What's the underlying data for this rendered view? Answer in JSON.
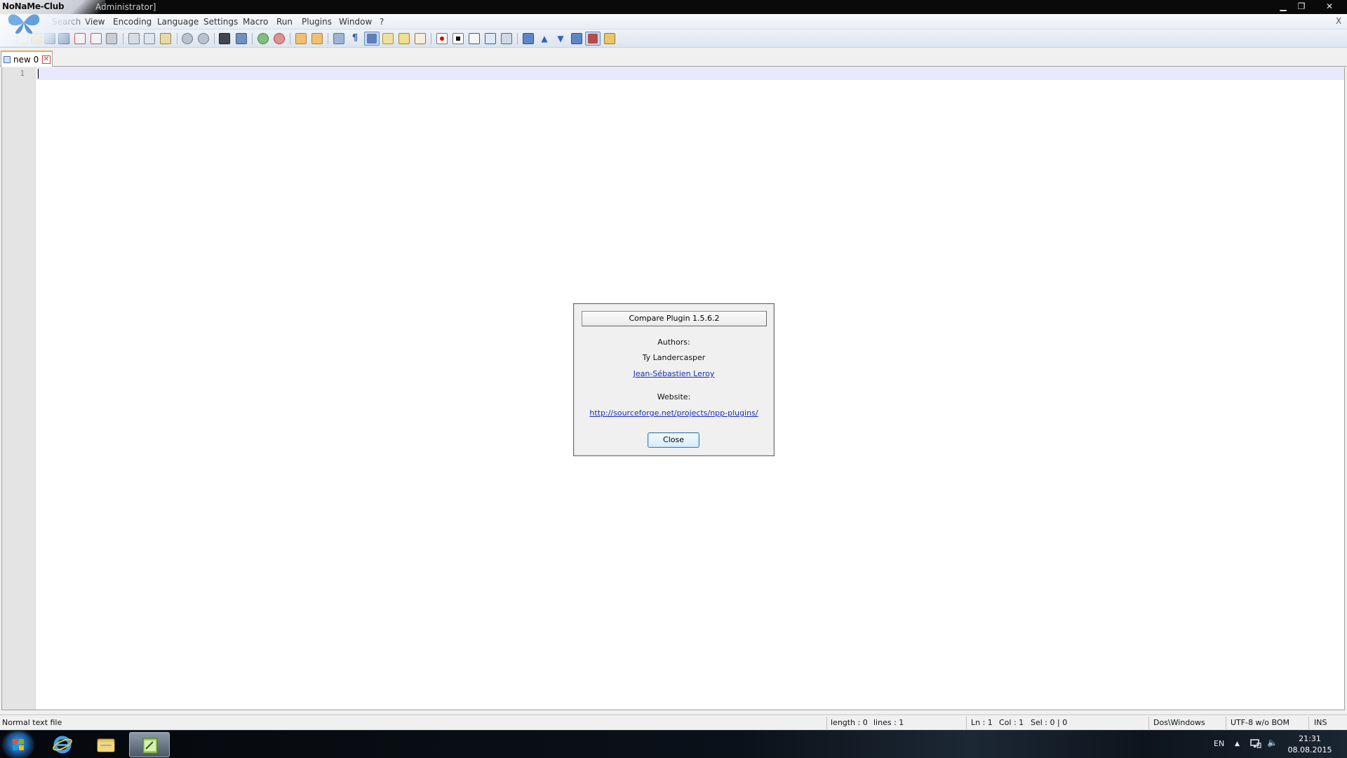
{
  "window": {
    "title": "Administrator]",
    "watermark": "NoNaMe-Club",
    "minimize_glyph": "▁",
    "maximize_glyph": "❐",
    "close_glyph": "✕"
  },
  "menu": {
    "items": [
      "Search",
      "View",
      "Encoding",
      "Language",
      "Settings",
      "Macro",
      "Run",
      "Plugins",
      "Window",
      "?"
    ],
    "doc_close": "X"
  },
  "tabs": [
    {
      "label": "new  0",
      "close_glyph": "✕"
    }
  ],
  "editor": {
    "line_numbers": [
      "1"
    ]
  },
  "dialog": {
    "title": "Compare Plugin 1.5.6.2",
    "authors_label": "Authors:",
    "author_1": "Ty Landercasper",
    "author_2": "Jean-Sébastien Leroy",
    "website_label": "Website:",
    "website_url": "http://sourceforge.net/projects/npp-plugins/",
    "close_label": "Close"
  },
  "statusbar": {
    "file_type": "Normal text file",
    "length": "length : 0",
    "lines": "lines : 1",
    "ln": "Ln : 1",
    "col": "Col : 1",
    "sel": "Sel : 0 | 0",
    "eol": "Dos\\Windows",
    "encoding": "UTF-8 w/o BOM",
    "mode": "INS"
  },
  "taskbar": {
    "language": "EN",
    "time": "21:31",
    "date": "08.08.2015",
    "show_hidden_glyph": "▲",
    "volume_glyph": "🔈"
  },
  "colors": {
    "accent_tab": "#f6a650",
    "link": "#1a2fb5",
    "current_line": "#e8e8ff"
  },
  "icons": {
    "toolbar": [
      "new-file-icon",
      "open-file-icon",
      "save-icon",
      "save-all-icon",
      "close-icon",
      "close-all-icon",
      "print-icon",
      "cut-icon",
      "copy-icon",
      "paste-icon",
      "undo-icon",
      "redo-icon",
      "find-icon",
      "replace-icon",
      "zoom-in-icon",
      "zoom-out-icon",
      "sync-vertical-icon",
      "sync-horizontal-icon",
      "word-wrap-icon",
      "show-all-chars-icon",
      "indent-guide-icon",
      "user-define-icon",
      "doc-map-icon",
      "function-list-icon",
      "record-macro-icon",
      "stop-record-icon",
      "play-macro-icon",
      "run-macro-multiple-icon",
      "save-macro-icon",
      "compare-icon",
      "prev-diff-icon",
      "next-diff-icon",
      "last-diff-icon",
      "spell-check-icon",
      "settings-icon"
    ]
  }
}
